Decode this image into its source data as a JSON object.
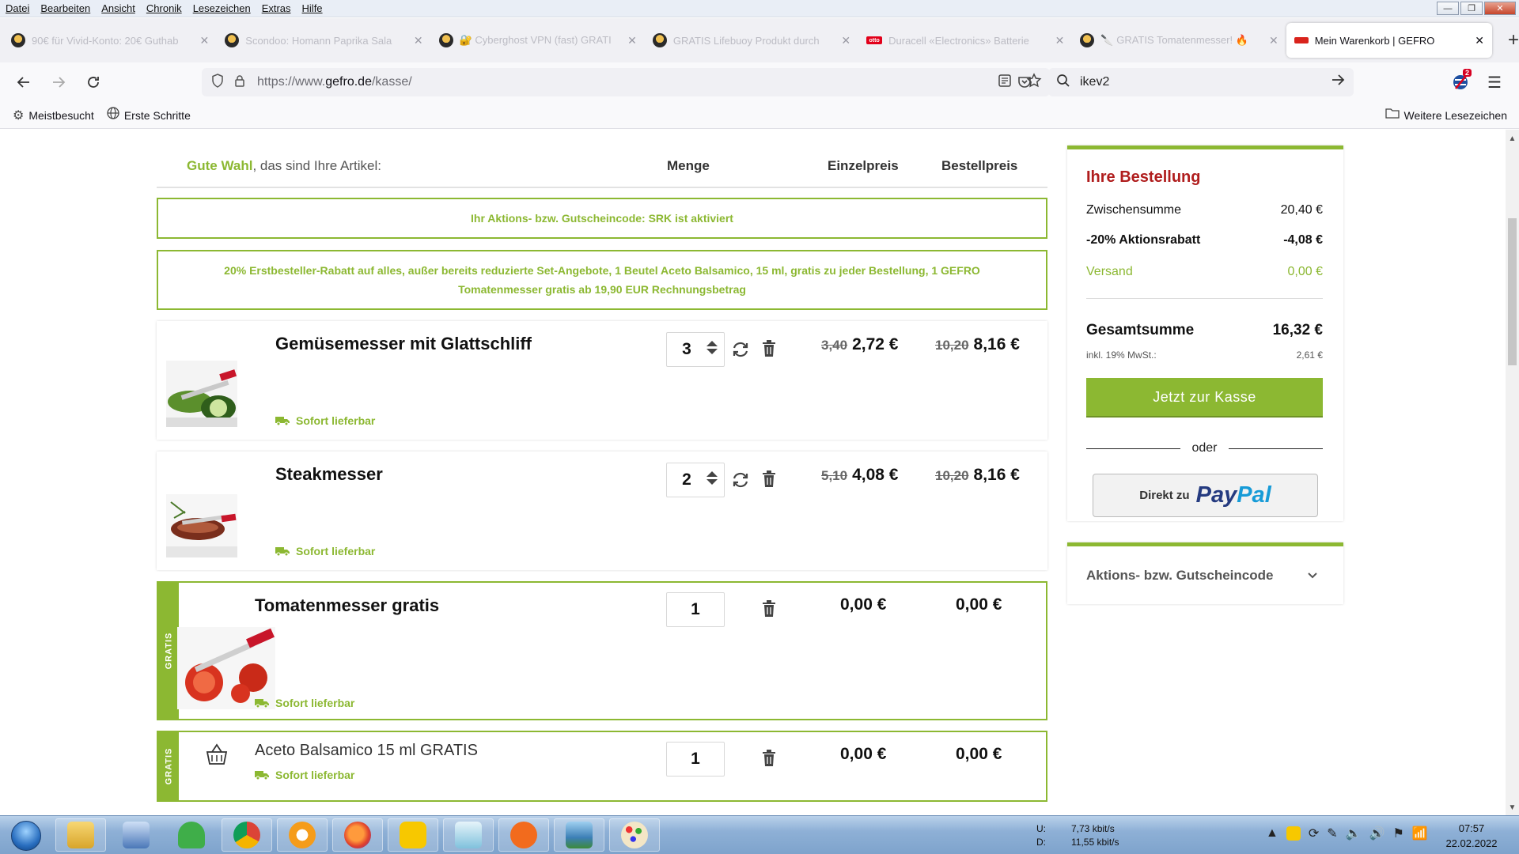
{
  "menu": [
    "Datei",
    "Bearbeiten",
    "Ansicht",
    "Chronik",
    "Lesezeichen",
    "Extras",
    "Hilfe"
  ],
  "tabs": [
    {
      "label": "90€ für Vivid-Konto: 20€ Guthab",
      "active": false
    },
    {
      "label": "Scondoo: Homann Paprika Sala",
      "active": false
    },
    {
      "label": "🔐 Cyberghost VPN (fast) GRATI",
      "active": false
    },
    {
      "label": "GRATIS Lifebuoy Produkt durch",
      "active": false
    },
    {
      "label": "Duracell «Electronics» Batterie",
      "active": false
    },
    {
      "label": "🔪 GRATIS Tomatenmesser! 🔥",
      "active": false
    },
    {
      "label": "Mein Warenkorb | GEFRO",
      "active": true
    }
  ],
  "address": {
    "base": "https://www.",
    "host": "gefro.de",
    "path": "/kasse/"
  },
  "search": {
    "value": "ikev2"
  },
  "extension_badge": "2",
  "bookmarks": {
    "most_visited": "Meistbesucht",
    "first_steps": "Erste Schritte",
    "other": "Weitere Lesezeichen"
  },
  "cart": {
    "intro_highlight": "Gute Wahl",
    "intro_rest": ", das sind Ihre Artikel:",
    "col_qty": "Menge",
    "col_unit": "Einzelpreis",
    "col_total": "Bestellpreis",
    "notice_code": "Ihr Aktions- bzw. Gutscheincode: SRK ist aktiviert",
    "notice_promo_line1": "20% Erstbesteller-Rabatt auf alles, außer bereits reduzierte Set-Angebote, 1 Beutel Aceto Balsamico, 15 ml, gratis zu jeder Bestellung, 1 GEFRO",
    "notice_promo_line2": "Tomatenmesser gratis ab 19,90 EUR Rechnungsbetrag",
    "gratis_label": "GRATIS",
    "items": [
      {
        "name": "Gemüsemesser mit Glattschliff",
        "delivery": "Sofort lieferbar",
        "qty": "3",
        "unit_old": "3,40",
        "unit": "2,72 €",
        "total_old": "10,20",
        "total": "8,16 €"
      },
      {
        "name": "Steakmesser",
        "delivery": "Sofort lieferbar",
        "qty": "2",
        "unit_old": "5,10",
        "unit": "4,08 €",
        "total_old": "10,20",
        "total": "8,16 €"
      },
      {
        "name": "Tomatenmesser gratis",
        "delivery": "Sofort lieferbar",
        "qty": "1",
        "unit": "0,00 €",
        "total": "0,00 €"
      },
      {
        "name": "Aceto Balsamico 15 ml GRATIS",
        "delivery": "Sofort lieferbar",
        "qty": "1",
        "unit": "0,00 €",
        "total": "0,00 €"
      }
    ]
  },
  "order": {
    "title": "Ihre Bestellung",
    "subtotal_label": "Zwischensumme",
    "subtotal": "20,40 €",
    "discount_label": "-20% Aktionsrabatt",
    "discount": "-4,08 €",
    "shipping_label": "Versand",
    "shipping": "0,00 €",
    "total_label": "Gesamtsumme",
    "total": "16,32 €",
    "vat_label": "inkl. 19% MwSt.:",
    "vat": "2,61 €",
    "checkout_label": "Jetzt zur Kasse",
    "or_label": "oder",
    "paypal_prefix": "Direkt zu",
    "paypal_brand_1": "Pay",
    "paypal_brand_2": "Pal"
  },
  "coupon": {
    "label": "Aktions- bzw. Gutscheincode"
  },
  "taskbar": {
    "net_up_label": "U:",
    "net_up": "7,73 kbit/s",
    "net_down_label": "D:",
    "net_down": "11,55 kbit/s",
    "time": "07:57",
    "date": "22.02.2022"
  },
  "colors": {
    "accent": "#8cb832",
    "title_red": "#b01d1d"
  }
}
